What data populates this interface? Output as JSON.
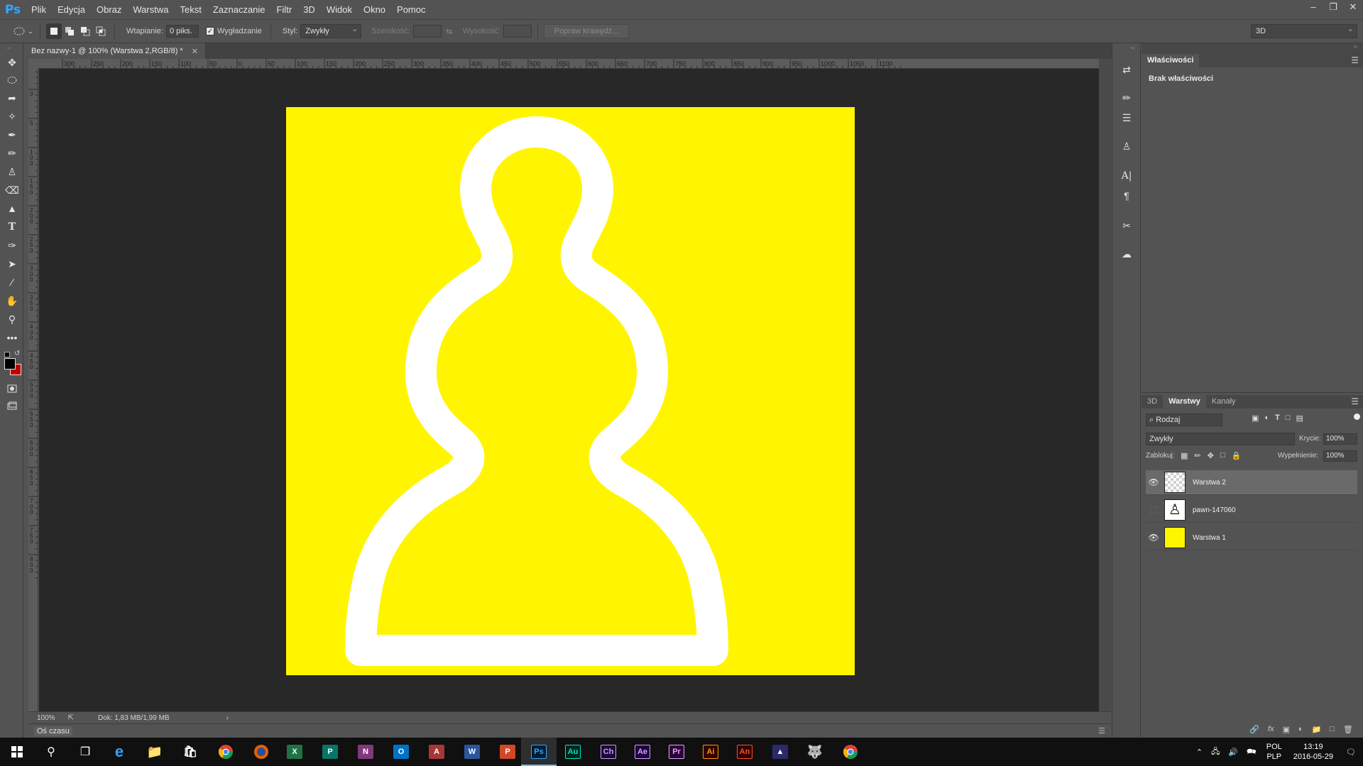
{
  "app": {
    "logo": "Ps",
    "menu": [
      "Plik",
      "Edycja",
      "Obraz",
      "Warstwa",
      "Tekst",
      "Zaznaczanie",
      "Filtr",
      "3D",
      "Widok",
      "Okno",
      "Pomoc"
    ],
    "window_controls": [
      "–",
      "❐",
      "✕"
    ]
  },
  "options": {
    "feather_label": "Wtapianie:",
    "feather_value": "0 piks.",
    "antialias_label": "Wygładzanie",
    "antialias_checked": true,
    "style_label": "Styl:",
    "style_value": "Zwykły",
    "width_label": "Szerokość:",
    "height_label": "Wysokość:",
    "refine_button": "Popraw krawędź...",
    "workspace_value": "3D"
  },
  "document": {
    "tab_title": "Bez nazwy-1 @ 100% (Warstwa 2,RGB/8) *",
    "canvas_color": "#fff500",
    "pawn_outline_color": "#ffffff",
    "ruler_h_labels": [
      "300",
      "250",
      "200",
      "150",
      "100",
      "50",
      "0",
      "50",
      "100",
      "150",
      "200",
      "250",
      "300",
      "350",
      "400",
      "450",
      "500",
      "550",
      "600",
      "650",
      "700",
      "750",
      "800",
      "850",
      "900",
      "950",
      "1000",
      "1050",
      "1100"
    ],
    "ruler_v_labels": [
      "5",
      "0",
      "5",
      "1\n0\n0",
      "1\n5\n0",
      "2\n0\n0",
      "2\n5\n0",
      "3\n0\n0",
      "3\n5\n0",
      "4\n0\n0",
      "4\n5\n0",
      "5\n0\n0",
      "5\n5\n0",
      "6\n0\n0",
      "6\n5\n0",
      "7\n0\n0",
      "7\n5\n0",
      "8\n0\n0"
    ]
  },
  "status": {
    "zoom": "100%",
    "doc_size": "Dok: 1,83 MB/1,99 MB",
    "timeline_label": "Oś czasu"
  },
  "tools": [
    "move-icon",
    "elliptical-marquee-icon",
    "lasso-icon",
    "magic-wand-icon",
    "eyedropper-icon",
    "brush-icon",
    "stamp-icon",
    "eraser-icon",
    "paint-bucket-icon",
    "type-icon",
    "pen-icon",
    "path-select-icon",
    "line-icon",
    "hand-icon",
    "zoom-icon",
    "more-tools-icon"
  ],
  "properties": {
    "tab": "Właściwości",
    "empty_text": "Brak właściwości"
  },
  "layers_panel": {
    "tabs": [
      "3D",
      "Warstwy",
      "Kanały"
    ],
    "active_tab": "Warstwy",
    "filter_label": "⌕ Rodzaj",
    "blend_mode": "Zwykły",
    "opacity_label": "Krycie:",
    "opacity_value": "100%",
    "lock_label": "Zablokuj:",
    "fill_label": "Wypełnienie:",
    "fill_value": "100%",
    "layers": [
      {
        "name": "Warstwa 2",
        "visible": true,
        "selected": true,
        "thumb": "transparent"
      },
      {
        "name": "pawn-147060",
        "visible": false,
        "selected": false,
        "thumb": "pawn"
      },
      {
        "name": "Warstwa 1",
        "visible": true,
        "selected": false,
        "thumb": "yellow"
      }
    ]
  },
  "taskbar": {
    "apps": [
      {
        "label": "Au",
        "color": "#00e4bb",
        "bg": "#00261c"
      },
      {
        "label": "Ch",
        "color": "#c59bff",
        "bg": "#1c0a33"
      },
      {
        "label": "Ae",
        "color": "#d8a1ff",
        "bg": "#1f0040"
      },
      {
        "label": "Pr",
        "color": "#e1a3ff",
        "bg": "#2a0634"
      },
      {
        "label": "Ai",
        "color": "#ff9a00",
        "bg": "#330000"
      },
      {
        "label": "An",
        "color": "#ff4b2b",
        "bg": "#330000"
      }
    ],
    "lang_top": "POL",
    "lang_bottom": "PLP",
    "time": "13:19",
    "date": "2016-05-29"
  }
}
